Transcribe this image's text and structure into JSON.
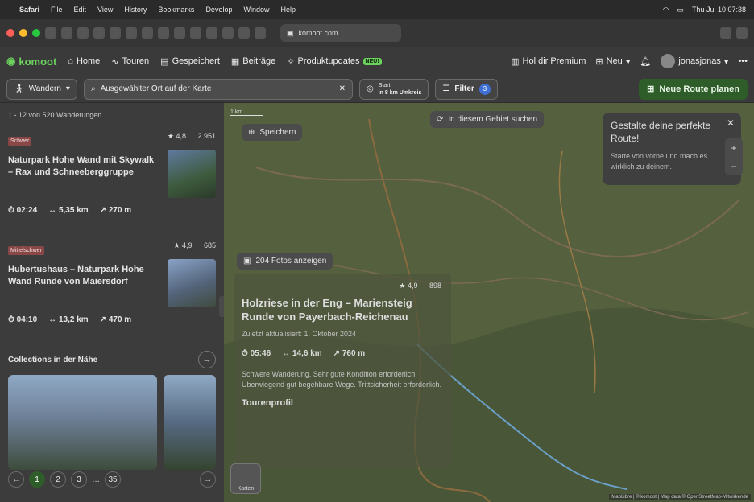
{
  "menubar": {
    "app": "Safari",
    "items": [
      "File",
      "Edit",
      "View",
      "History",
      "Bookmarks",
      "Develop",
      "Window",
      "Help"
    ],
    "clock": "Thu Jul 10  07:38"
  },
  "browser": {
    "url": "komoot.com"
  },
  "nav": {
    "logo": "komoot",
    "home": "Home",
    "tours": "Touren",
    "saved": "Gespeichert",
    "posts": "Beiträge",
    "updates": "Produktupdates",
    "new_badge": "NEU!",
    "premium": "Hol dir Premium",
    "new_menu": "Neu",
    "username": "jonasjonas"
  },
  "filters": {
    "activity": "Wandern",
    "search_value": "Ausgewählter Ort auf der Karte",
    "start_label": "Start",
    "start_radius": "in 8 km Umkreis",
    "filter_label": "Filter",
    "filter_count": "3",
    "cta": "Neue Route planen"
  },
  "list": {
    "count": "1 - 12 von 520 Wanderungen",
    "tours": [
      {
        "difficulty": "Schwer",
        "rating": "4,8",
        "reviews": "2.951",
        "title": "Naturpark Hohe Wand mit Skywalk – Rax und Schneeberggruppe",
        "time": "02:24",
        "distance": "5,35 km",
        "ascent": "270 m"
      },
      {
        "difficulty": "Mittelschwer",
        "rating": "4,9",
        "reviews": "685",
        "title": "Hubertushaus – Naturpark Hohe Wand Runde von Maiersdorf",
        "time": "04:10",
        "distance": "13,2 km",
        "ascent": "470 m"
      }
    ],
    "collections_title": "Collections in der Nähe",
    "pages": [
      "1",
      "2",
      "3",
      "…",
      "35"
    ]
  },
  "map": {
    "scale": "1 km",
    "save": "Speichern",
    "search_area": "In diesem Gebiet suchen",
    "photos": "204 Fotos anzeigen",
    "tooltip_title": "Gestalte deine perfekte Route!",
    "tooltip_text": "Starte von vorne und mach es wirklich zu deinem.",
    "detail": {
      "rating": "4,9",
      "reviews": "898",
      "title": "Holzriese in der Eng – Mariensteig Runde von Payerbach-Reichenau",
      "meta": "Zuletzt aktualisiert: 1. Oktober 2024",
      "time": "05:46",
      "distance": "14,6 km",
      "ascent": "760 m",
      "desc": "Schwere Wanderung. Sehr gute Kondition erforderlich. Überwiegend gut begehbare Wege. Trittsicherheit erforderlich.",
      "profile": "Tourenprofil"
    },
    "layers_label": "Karten",
    "attribution": "MapLibre | © komoot | Map data © OpenStreetMap-Mitwirkende"
  },
  "colors": {
    "brand": "#6bd25e",
    "cta": "#2f5d2a",
    "filter_badge": "#3f6fd3",
    "difficulty": "#8a4747"
  }
}
